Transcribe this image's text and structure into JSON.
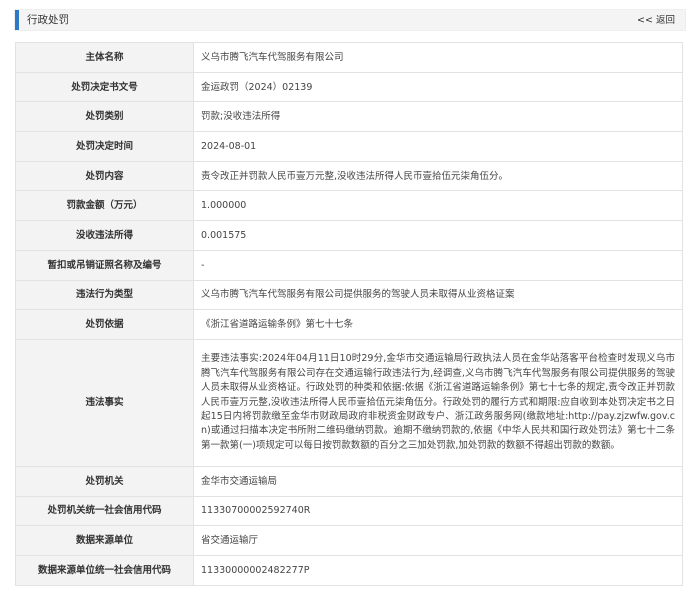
{
  "header": {
    "title": "行政处罚",
    "back_label": "<< 返回"
  },
  "rows": [
    {
      "label": "主体名称",
      "value": "义乌市腾飞汽车代驾服务有限公司"
    },
    {
      "label": "处罚决定书文号",
      "value": "金运政罚（2024）02139"
    },
    {
      "label": "处罚类别",
      "value": "罚款;没收违法所得"
    },
    {
      "label": "处罚决定时间",
      "value": "2024-08-01"
    },
    {
      "label": "处罚内容",
      "value": "责令改正并罚款人民币壹万元整,没收违法所得人民币壹拾伍元柒角伍分。"
    },
    {
      "label": "罚款金额（万元）",
      "value": "1.000000"
    },
    {
      "label": "没收违法所得",
      "value": "0.001575"
    },
    {
      "label": "暂扣或吊销证照名称及编号",
      "value": "-"
    },
    {
      "label": "违法行为类型",
      "value": "义乌市腾飞汽车代驾服务有限公司提供服务的驾驶人员未取得从业资格证案"
    },
    {
      "label": "处罚依据",
      "value": "《浙江省道路运输条例》第七十七条"
    },
    {
      "label": "违法事实",
      "value": "主要违法事实:2024年04月11日10时29分,金华市交通运输局行政执法人员在金华站落客平台检查时发现义乌市腾飞汽车代驾服务有限公司存在交通运输行政违法行为,经调查,义乌市腾飞汽车代驾服务有限公司提供服务的驾驶人员未取得从业资格证。行政处罚的种类和依据:依据《浙江省道路运输条例》第七十七条的规定,责令改正并罚款人民币壹万元整,没收违法所得人民币壹拾伍元柒角伍分。行政处罚的履行方式和期限:应自收到本处罚决定书之日起15日内将罚款缴至金华市财政局政府非税资金财政专户、浙江政务服务网(缴款地址:http://pay.zjzwfw.gov.cn)或通过扫描本决定书所附二维码缴纳罚款。逾期不缴纳罚款的,依据《中华人民共和国行政处罚法》第七十二条第一款第(一)项规定可以每日按罚款数额的百分之三加处罚款,加处罚款的数额不得超出罚款的数额。"
    },
    {
      "label": "处罚机关",
      "value": "金华市交通运输局"
    },
    {
      "label": "处罚机关统一社会信用代码",
      "value": "11330700002592740R"
    },
    {
      "label": "数据来源单位",
      "value": "省交通运输厅"
    },
    {
      "label": "数据来源单位统一社会信用代码",
      "value": "11330000002482277P"
    }
  ]
}
